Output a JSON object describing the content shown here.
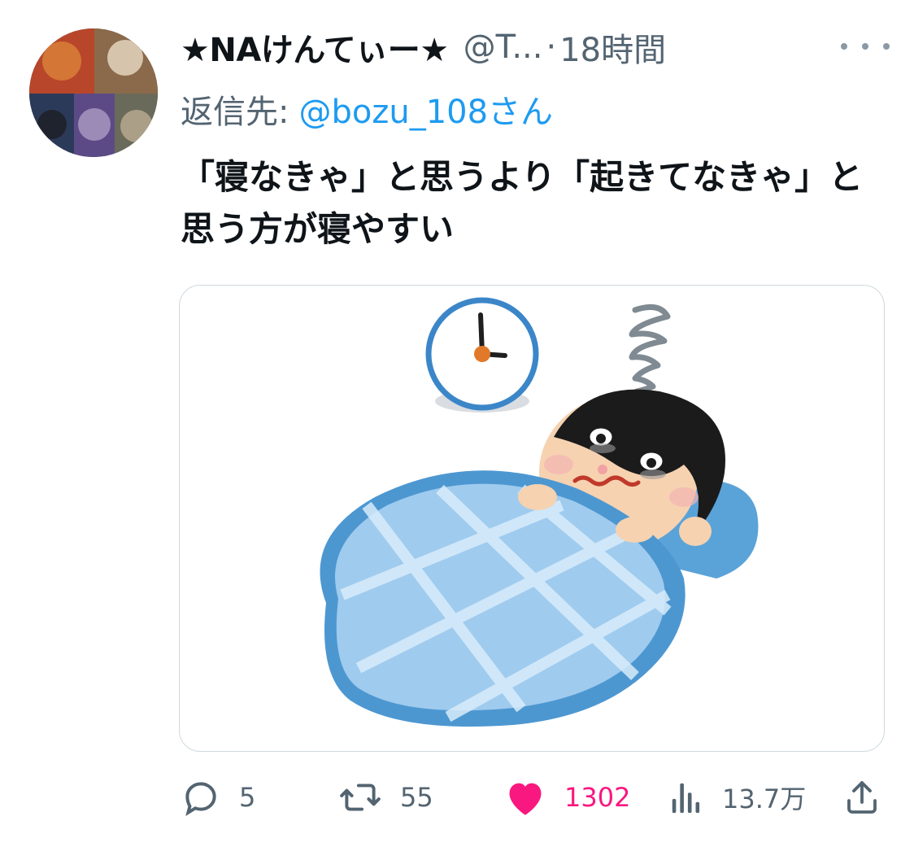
{
  "tweet": {
    "display_name": "★NAけんてぃー★",
    "handle": "@T...",
    "separator": "·",
    "time": "18時間",
    "reply_prefix": "返信先:",
    "reply_mention": "@bozu_108さん",
    "text": "「寝なきゃ」と思うより「起きてなきゃ」と思う方が寝やすい"
  },
  "actions": {
    "replies": "5",
    "retweets": "55",
    "likes": "1302",
    "views": "13.7万"
  },
  "colors": {
    "text": "#0f1419",
    "secondary": "#536471",
    "link": "#1d9bf0",
    "like": "#f91880"
  },
  "icons": [
    "more-icon",
    "reply-icon",
    "retweet-icon",
    "heart-icon",
    "views-icon",
    "share-icon"
  ]
}
